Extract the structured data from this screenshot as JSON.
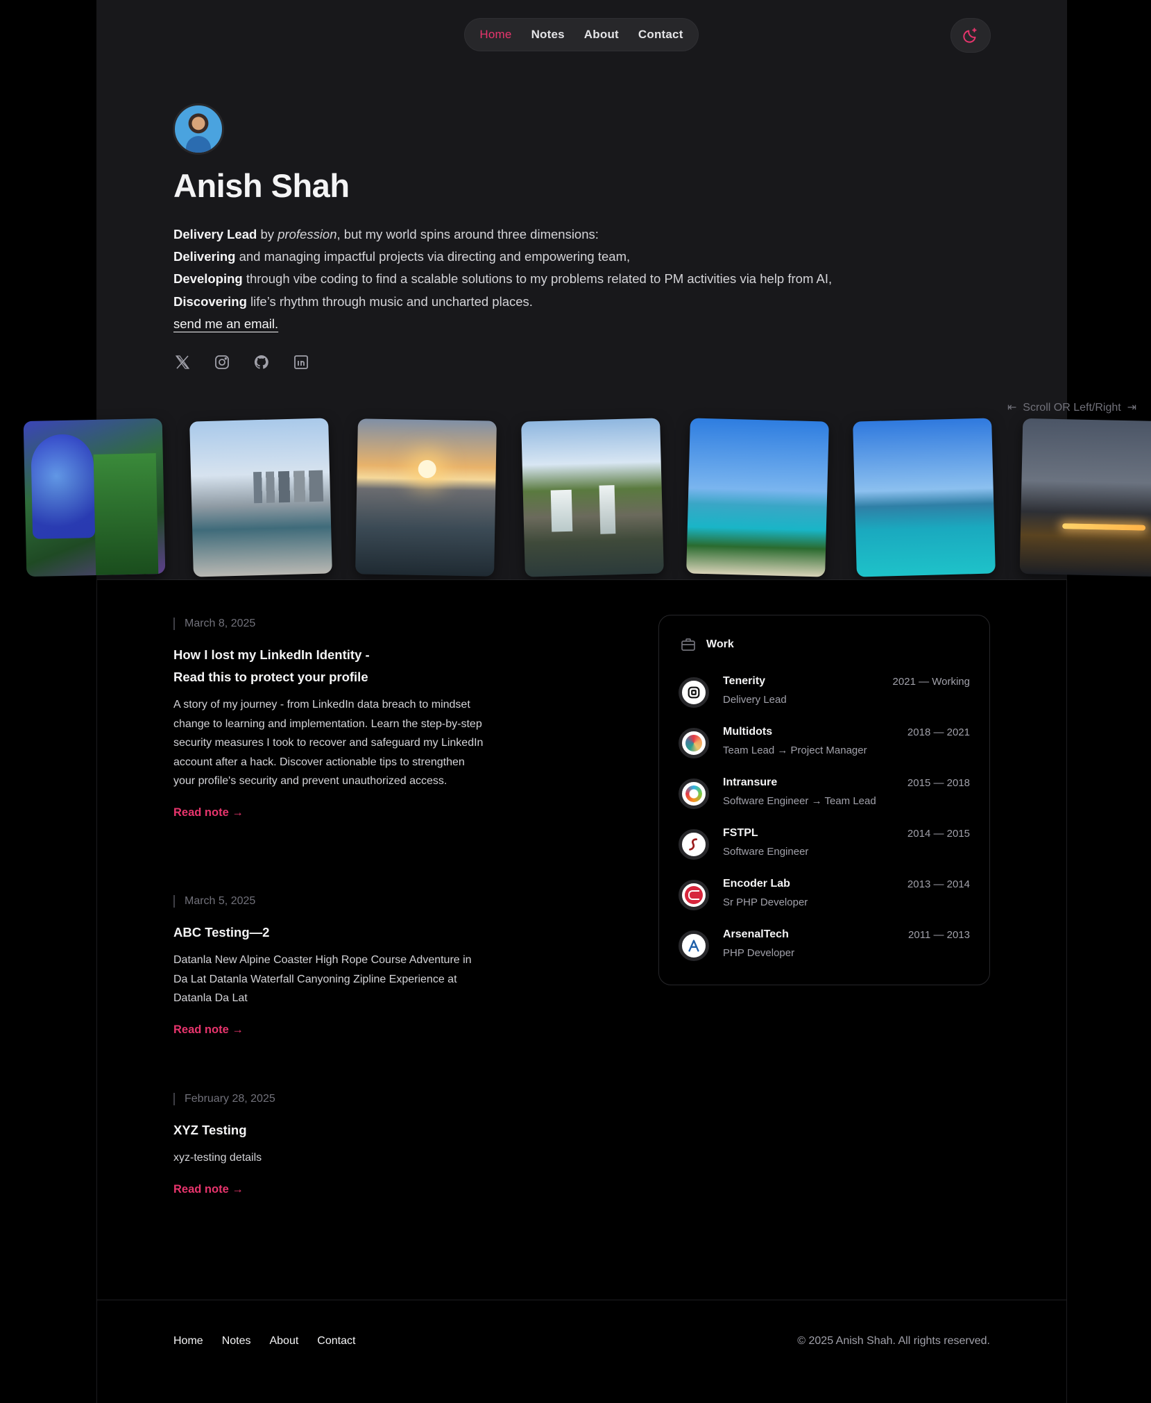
{
  "nav": {
    "items": [
      {
        "label": "Home",
        "active": true
      },
      {
        "label": "Notes"
      },
      {
        "label": "About"
      },
      {
        "label": "Contact"
      }
    ]
  },
  "theme_toggle": {
    "icon": "moon-sparkle-icon",
    "accent": "#e8356d"
  },
  "hero": {
    "name": "Anish Shah",
    "bio": {
      "line1_bold": "Delivery Lead",
      "line1_by": " by ",
      "line1_italic": "profession",
      "line1_rest": ", but my world spins around three dimensions:",
      "line2_bold": "Delivering",
      "line2_rest": " and managing impactful projects via directing and empowering team,",
      "line3_bold": "Developing",
      "line3_rest": " through vibe coding to find a scalable solutions to my problems related to PM activities via help from AI,",
      "line4_bold": "Discovering",
      "line4_rest": " life’s rhythm through music and uncharted places.",
      "email_link": "send me an email."
    },
    "socials": [
      "x-icon",
      "instagram-icon",
      "github-icon",
      "linkedin-icon"
    ]
  },
  "gallery": {
    "hint": "Scroll OR Left/Right",
    "photos": [
      "garden-photo",
      "merlion-photo",
      "sunset-sea-photo",
      "waterfall-photo",
      "beach-photo",
      "bay-photo",
      "night-city-photo"
    ]
  },
  "notes": [
    {
      "date": "March 8, 2025",
      "title": "How I lost my LinkedIn Identity - Read this to protect your profile",
      "excerpt": "A story of my journey - from LinkedIn data breach to mindset change to learning and implementation. Learn the step-by-step security measures I took to recover and safeguard my LinkedIn account after a hack. Discover actionable tips to strengthen your profile's security and prevent unauthorized access.",
      "link": "Read note →"
    },
    {
      "date": "March 5, 2025",
      "title": "ABC Testing—2",
      "excerpt": "Datanla New Alpine Coaster High Rope Course Adventure in Da Lat Datanla Waterfall Canyoning Zipline Experience at Datanla Da Lat",
      "link": "Read note →"
    },
    {
      "date": "February 28, 2025",
      "title": "XYZ Testing",
      "excerpt": "xyz-testing details",
      "link": "Read note →"
    }
  ],
  "work": {
    "title": "Work",
    "jobs": [
      {
        "company": "Tenerity",
        "role": "Delivery Lead",
        "years": "2021 — Working"
      },
      {
        "company": "Multidots",
        "role": "Team Lead → Project Manager",
        "years": "2018 — 2021"
      },
      {
        "company": "Intransure",
        "role": "Software Engineer → Team Lead",
        "years": "2015 — 2018"
      },
      {
        "company": "FSTPL",
        "role": "Software Engineer",
        "years": "2014 — 2015"
      },
      {
        "company": "Encoder Lab",
        "role": "Sr PHP Developer",
        "years": "2013 — 2014"
      },
      {
        "company": "ArsenalTech",
        "role": "PHP Developer",
        "years": "2011 — 2013"
      }
    ]
  },
  "footer": {
    "links": [
      "Home",
      "Notes",
      "About",
      "Contact"
    ],
    "copyright": "© 2025 Anish Shah. All rights reserved."
  }
}
